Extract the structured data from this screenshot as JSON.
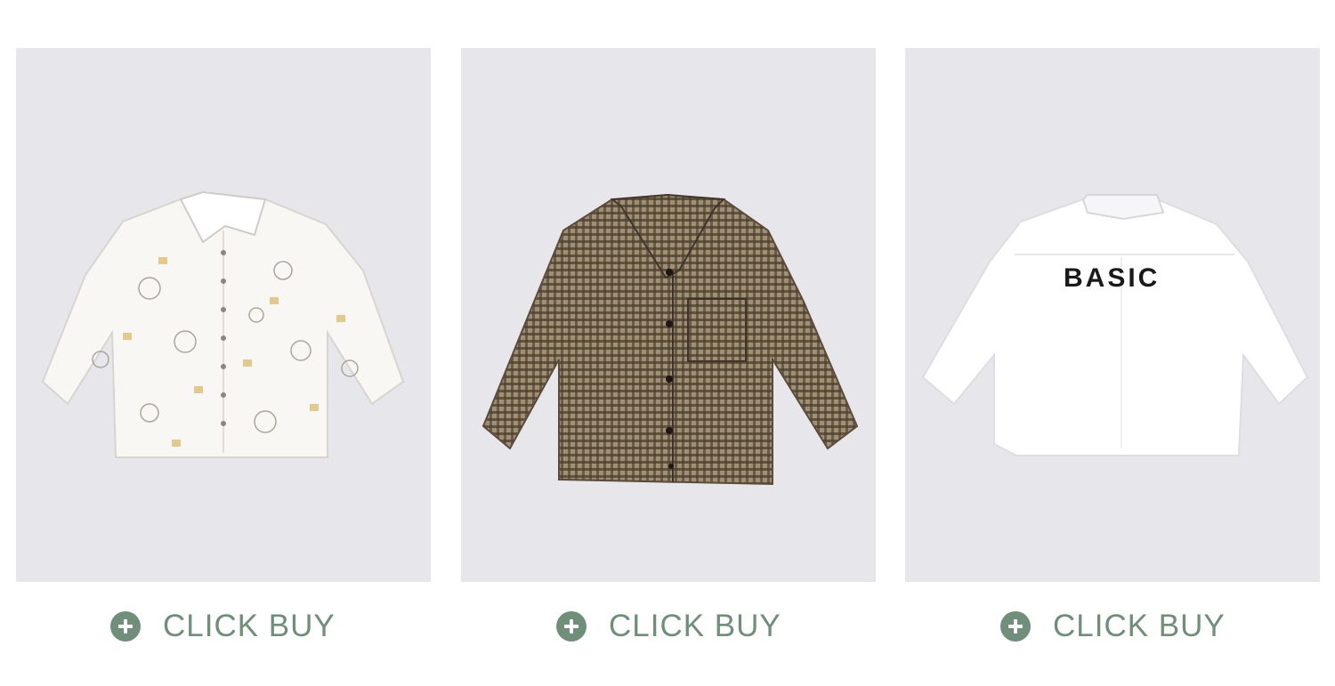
{
  "products": [
    {
      "image_alt": "white printed long-sleeve shirt",
      "buy_label": "CLICK BUY",
      "icon": "plus-circle-icon"
    },
    {
      "image_alt": "brown check long-sleeve shirt",
      "buy_label": "CLICK BUY",
      "icon": "plus-circle-icon"
    },
    {
      "image_alt": "white long-sleeve shirt back view",
      "buy_label": "CLICK BUY",
      "print_text": "BASIC",
      "icon": "plus-circle-icon"
    }
  ],
  "colors": {
    "card_bg": "#e7e7eb",
    "accent": "#6f8f7a"
  }
}
